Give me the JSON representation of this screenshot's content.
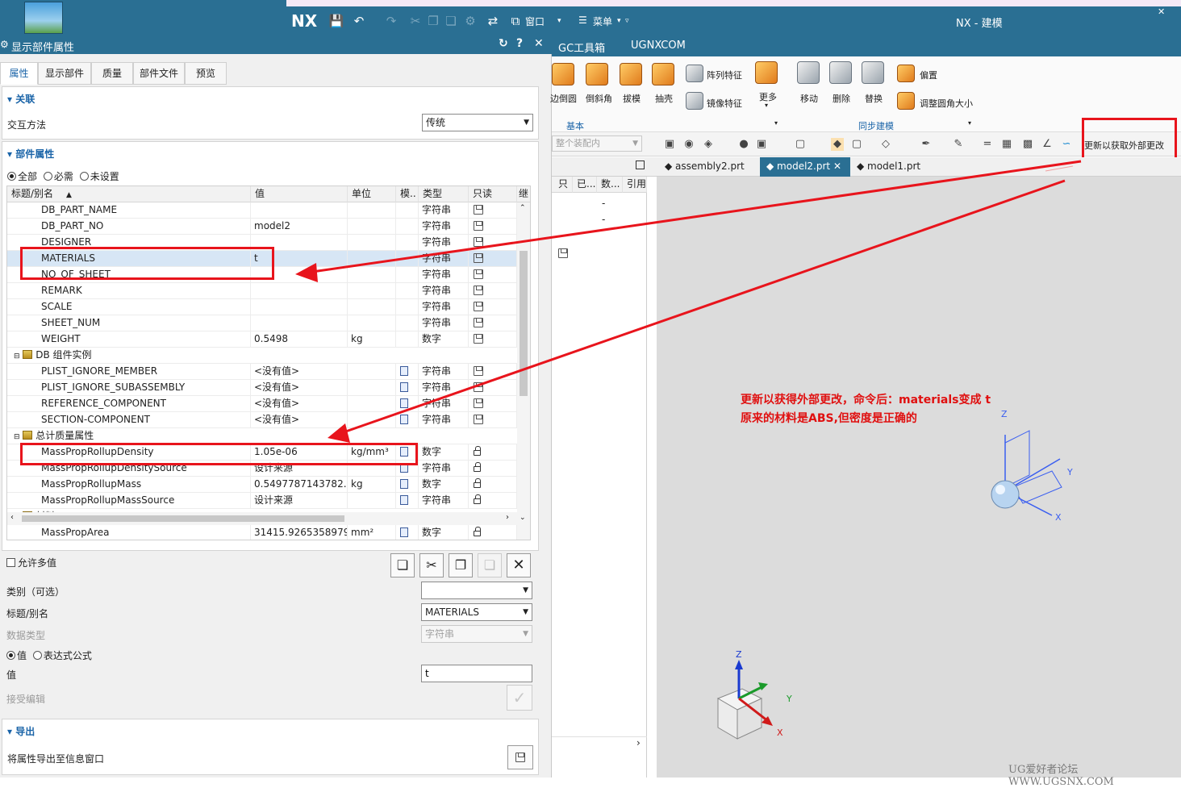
{
  "app": {
    "logo": "NX",
    "title": "NX - 建模",
    "window_menu": "窗口",
    "menu": "菜单"
  },
  "dialog": {
    "title": "显示部件属性",
    "tabs": [
      "属性",
      "显示部件",
      "质量",
      "部件文件",
      "预览"
    ],
    "section_assoc": "关联",
    "interaction_label": "交互方法",
    "interaction_value": "传统",
    "section_props": "部件属性",
    "filter_options": [
      "全部",
      "必需",
      "未设置"
    ],
    "columns": [
      "标题/别名",
      "值",
      "单位",
      "模..",
      "类型",
      "只读",
      "继"
    ],
    "rows": [
      {
        "name": "DB_PART_NAME",
        "value": "",
        "unit": "",
        "type": "字符串",
        "icon": "disk",
        "level": 2
      },
      {
        "name": "DB_PART_NO",
        "value": "model2",
        "unit": "",
        "type": "字符串",
        "icon": "disk",
        "level": 2
      },
      {
        "name": "DESIGNER",
        "value": "",
        "unit": "",
        "type": "字符串",
        "icon": "disk",
        "level": 2
      },
      {
        "name": "MATERIALS",
        "value": "t",
        "unit": "",
        "type": "字符串",
        "icon": "disk",
        "level": 2,
        "selected": true
      },
      {
        "name": "NO_OF_SHEET",
        "value": "",
        "unit": "",
        "type": "字符串",
        "icon": "disk",
        "level": 2
      },
      {
        "name": "REMARK",
        "value": "",
        "unit": "",
        "type": "字符串",
        "icon": "disk",
        "level": 2
      },
      {
        "name": "SCALE",
        "value": "",
        "unit": "",
        "type": "字符串",
        "icon": "disk",
        "level": 2
      },
      {
        "name": "SHEET_NUM",
        "value": "",
        "unit": "",
        "type": "字符串",
        "icon": "disk",
        "level": 2
      },
      {
        "name": "WEIGHT",
        "value": "0.5498",
        "unit": "kg",
        "type": "数字",
        "icon": "disk",
        "level": 2
      },
      {
        "name": "DB 组件实例",
        "group": true,
        "level": 1
      },
      {
        "name": "PLIST_IGNORE_MEMBER",
        "value": "<没有值>",
        "unit": "",
        "type": "字符串",
        "icon": "disk",
        "doc": true,
        "level": 2
      },
      {
        "name": "PLIST_IGNORE_SUBASSEMBLY",
        "value": "<没有值>",
        "unit": "",
        "type": "字符串",
        "icon": "disk",
        "doc": true,
        "level": 2
      },
      {
        "name": "REFERENCE_COMPONENT",
        "value": "<没有值>",
        "unit": "",
        "type": "字符串",
        "icon": "disk",
        "doc": true,
        "level": 2
      },
      {
        "name": "SECTION-COMPONENT",
        "value": "<没有值>",
        "unit": "",
        "type": "字符串",
        "icon": "disk",
        "doc": true,
        "level": 2
      },
      {
        "name": "总计质量属性",
        "group": true,
        "level": 1
      },
      {
        "name": "MassPropRollupDensity",
        "value": "1.05e-06",
        "unit": "kg/mm³",
        "type": "数字",
        "icon": "lock",
        "doc": true,
        "level": 2
      },
      {
        "name": "MassPropRollupDensitySource",
        "value": "设计来源",
        "unit": "",
        "type": "字符串",
        "icon": "lock",
        "doc": true,
        "level": 2
      },
      {
        "name": "MassPropRollupMass",
        "value": "0.5497787143782...",
        "unit": "kg",
        "type": "数字",
        "icon": "lock",
        "doc": true,
        "level": 2
      },
      {
        "name": "MassPropRollupMassSource",
        "value": "设计来源",
        "unit": "",
        "type": "字符串",
        "icon": "lock",
        "doc": true,
        "level": 2
      },
      {
        "name": "材料",
        "group": true,
        "level": 1
      },
      {
        "name": "MassPropArea",
        "value": "31415.9265358979",
        "unit": "mm²",
        "type": "数字",
        "icon": "lock",
        "doc": true,
        "level": 2
      }
    ],
    "allow_multi": "允许多值",
    "category_label": "类别（可选）",
    "title_alias_label": "标题/别名",
    "title_alias_value": "MATERIALS",
    "datatype_label": "数据类型",
    "datatype_value": "字符串",
    "value_mode": [
      "值",
      "表达式公式"
    ],
    "value_label": "值",
    "value_value": "t",
    "accept_edit": "接受编辑",
    "section_export": "导出",
    "export_label": "将属性导出至信息窗口"
  },
  "ribbon": {
    "menus": [
      "GC工具箱",
      "UGNXCOM"
    ],
    "buttons": [
      "边倒圆",
      "倒斜角",
      "拔模",
      "抽壳",
      "阵列特征",
      "镜像特征",
      "更多",
      "移动",
      "删除",
      "替换",
      "偏置",
      "调整圆角大小"
    ],
    "groups": [
      "基本",
      "同步建模"
    ],
    "filter_placeholder": "整个装配内",
    "update_button": "更新以获取外部更改"
  },
  "nav": {
    "cols": [
      "只",
      "已...",
      "数...",
      "引用"
    ],
    "cells": [
      "-",
      "-"
    ]
  },
  "file_tabs": [
    "assembly2.prt",
    "model2.prt",
    "model1.prt"
  ],
  "annotation": {
    "line1": "更新以获得外部更改，命令后：materials变成  t",
    "line2": "原来的材料是ABS,但密度是正确的"
  },
  "axes": {
    "x": "X",
    "y": "Y",
    "z": "Z"
  },
  "watermark": "UG爱好者论坛 WWW.UGSNX.COM",
  "colors": {
    "titlebar": "#2a6f93",
    "highlight": "#e8141c",
    "link": "#1a64a8"
  }
}
